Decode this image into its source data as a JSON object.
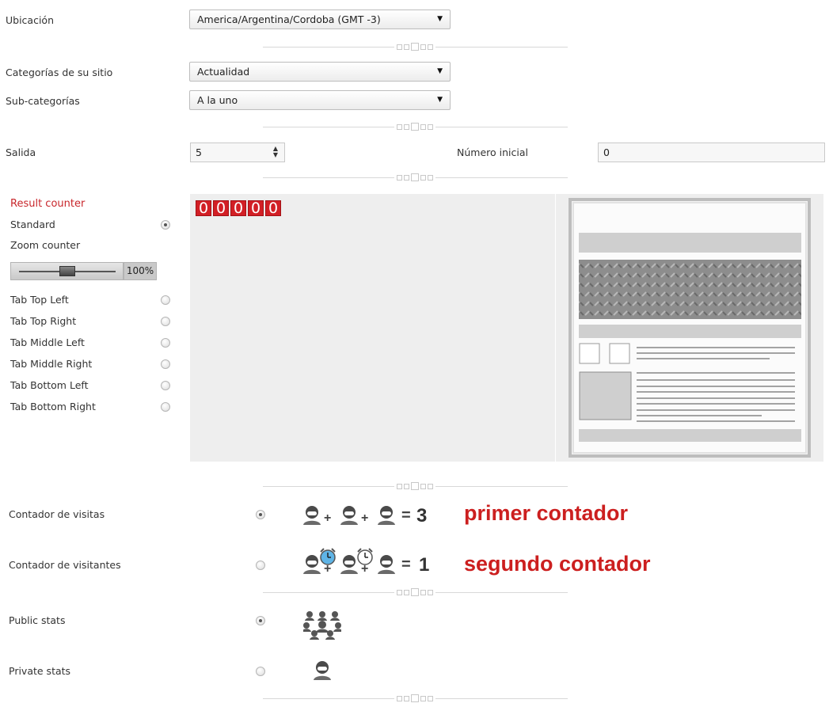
{
  "location": {
    "label": "Ubicación",
    "value": "America/Argentina/Cordoba (GMT -3)"
  },
  "categories": {
    "label": "Categorías de su sitio",
    "value": "Actualidad"
  },
  "subcategories": {
    "label": "Sub-categorías",
    "value": "A la uno"
  },
  "output": {
    "label": "Salida",
    "value": "5"
  },
  "initial_number": {
    "label": "Número inicial",
    "value": "0"
  },
  "counter_options": {
    "title": "Result counter",
    "standard": "Standard",
    "zoom": "Zoom counter",
    "zoom_value": "100%",
    "zoom_level": 0.5,
    "tabs": [
      "Tab Top Left",
      "Tab Top Right",
      "Tab Middle Left",
      "Tab Middle Right",
      "Tab Bottom Left",
      "Tab Bottom Right"
    ],
    "selected": "Standard"
  },
  "preview": {
    "digits": [
      "0",
      "0",
      "0",
      "0",
      "0"
    ]
  },
  "counter_type": {
    "visits": {
      "label": "Contador de visitas",
      "equation_result": "3",
      "note": "primer contador",
      "selected": true
    },
    "visitors": {
      "label": "Contador de visitantes",
      "equation_result": "1",
      "note": "segundo contador",
      "selected": false
    }
  },
  "stats": {
    "public": {
      "label": "Public stats",
      "selected": true
    },
    "private": {
      "label": "Private stats",
      "selected": false
    }
  },
  "colors": {
    "accent_red": "#cc1f1f",
    "digit_red": "#d21f25"
  }
}
